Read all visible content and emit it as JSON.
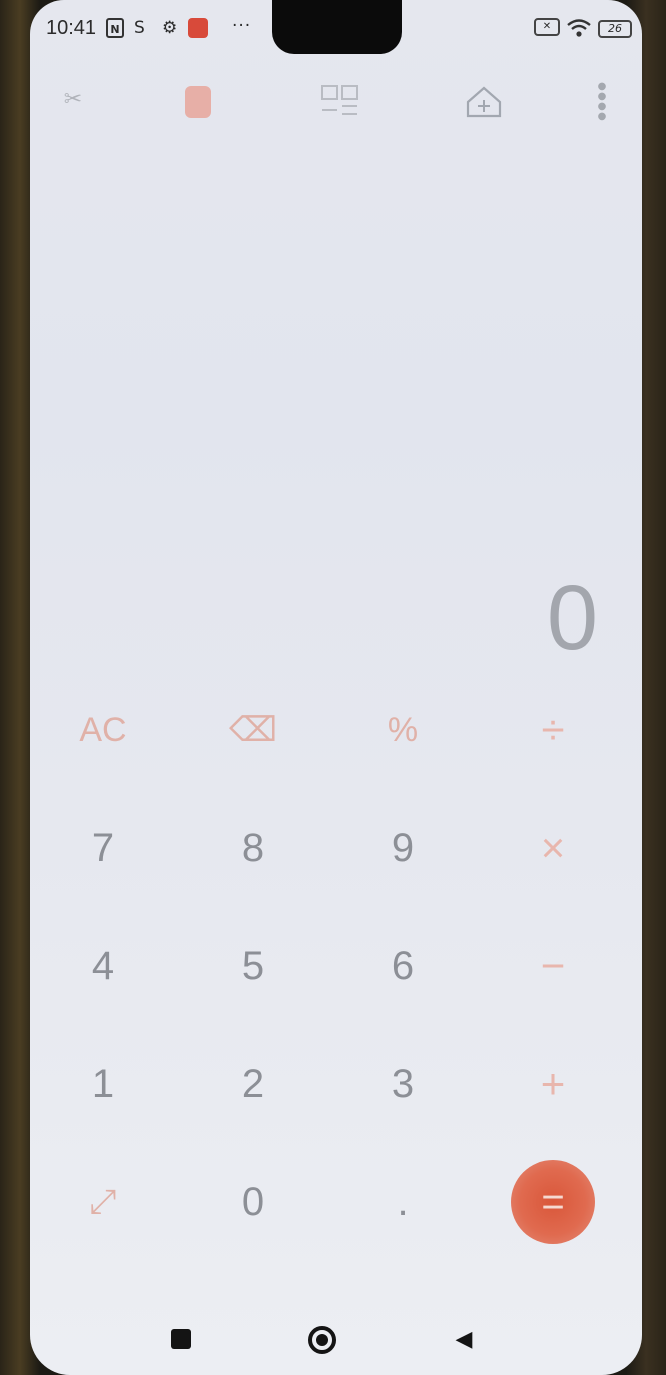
{
  "status_bar": {
    "time": "10:41",
    "nfc_icon": "N",
    "s_icon": "S",
    "gear_icon": "⚙",
    "more_dots": "···",
    "vpn_icon": "✕",
    "wifi_icon": "wifi",
    "battery_level": "26"
  },
  "toolbar": {
    "mode_icon": "scissors-icon",
    "calculator_icon": "calculator-icon",
    "scientific_icon": "scientific-icon",
    "convert_icon": "house-convert-icon",
    "more_icon": "vertical-dots-icon"
  },
  "display": {
    "value": "0"
  },
  "keypad": {
    "keys": [
      {
        "label": "AC",
        "kind": "fn"
      },
      {
        "label": "⌫",
        "kind": "fn"
      },
      {
        "label": "%",
        "kind": "fn"
      },
      {
        "label": "÷",
        "kind": "op"
      },
      {
        "label": "7",
        "kind": "num"
      },
      {
        "label": "8",
        "kind": "num"
      },
      {
        "label": "9",
        "kind": "num"
      },
      {
        "label": "×",
        "kind": "op"
      },
      {
        "label": "4",
        "kind": "num"
      },
      {
        "label": "5",
        "kind": "num"
      },
      {
        "label": "6",
        "kind": "num"
      },
      {
        "label": "−",
        "kind": "op"
      },
      {
        "label": "1",
        "kind": "num"
      },
      {
        "label": "2",
        "kind": "num"
      },
      {
        "label": "3",
        "kind": "num"
      },
      {
        "label": "+",
        "kind": "op"
      },
      {
        "label": "⤢",
        "kind": "fn"
      },
      {
        "label": "0",
        "kind": "num"
      },
      {
        "label": ".",
        "kind": "num"
      },
      {
        "label": "=",
        "kind": "equals"
      }
    ]
  },
  "nav_bar": {
    "recents_icon": "recents-icon",
    "home_icon": "home-icon",
    "back_icon": "◀"
  },
  "colors": {
    "accent": "#d9573a",
    "screen_bg": "#e5e7ee",
    "key_text": "#8c8f96"
  }
}
